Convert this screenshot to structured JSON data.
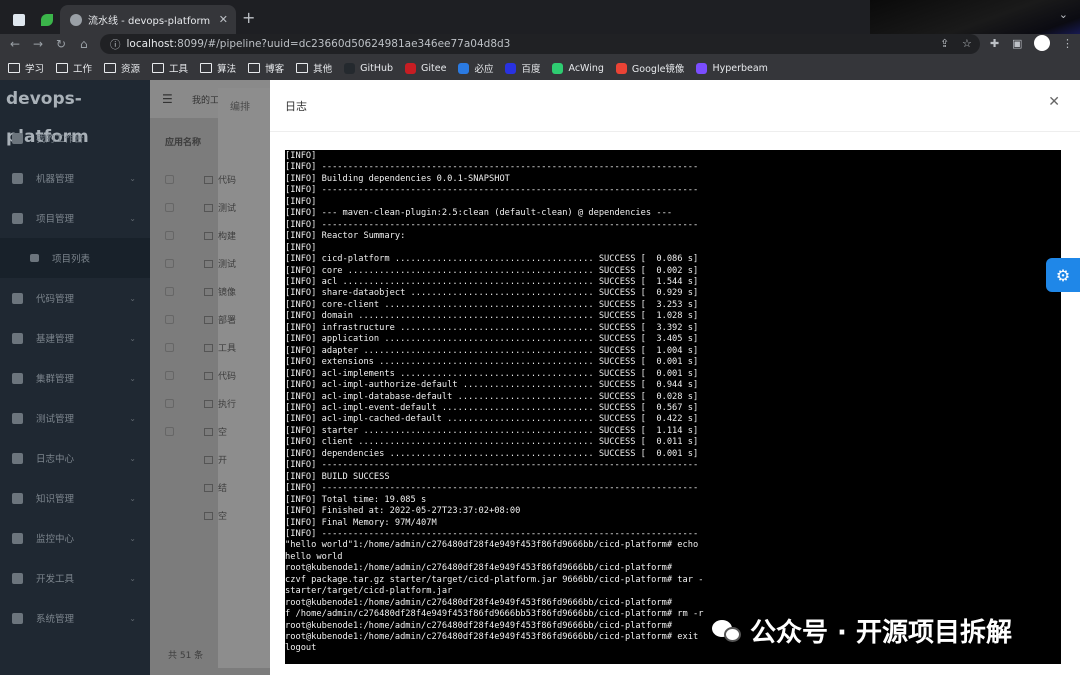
{
  "browser": {
    "active_tab_title": "流水线 - devops-platform",
    "url_host": "localhost",
    "url_rest": ":8099/#/pipeline?uuid=dc23660d50624981ae346ee77a04d8d3",
    "bookmarks": [
      "学习",
      "工作",
      "资源",
      "工具",
      "算法",
      "博客",
      "其他",
      "GitHub",
      "Gitee",
      "必应",
      "百度",
      "AcWing",
      "Google镜像",
      "Hyperbeam"
    ],
    "bookmark_colors": {
      "GitHub": "#24292e",
      "Gitee": "#c71d23",
      "必应": "#2a7ae2",
      "百度": "#2932e1",
      "AcWing": "#2ecc71",
      "Google镜像": "#ea4335",
      "Hyperbeam": "#7b4dff"
    }
  },
  "sidebar": {
    "logo": "devops-platform",
    "items": [
      {
        "label": "我的工作台",
        "icon": "dashboard-icon",
        "arrow": false
      },
      {
        "label": "机器管理",
        "icon": "grid-icon",
        "arrow": true
      },
      {
        "label": "项目管理",
        "icon": "edit-icon",
        "arrow": true
      },
      {
        "label": "项目列表",
        "icon": "list-icon",
        "arrow": false,
        "sub": true
      },
      {
        "label": "代码管理",
        "icon": "code-icon",
        "arrow": true
      },
      {
        "label": "基建管理",
        "icon": "build-icon",
        "arrow": true
      },
      {
        "label": "集群管理",
        "icon": "send-icon",
        "arrow": true
      },
      {
        "label": "测试管理",
        "icon": "chart-icon",
        "arrow": true
      },
      {
        "label": "日志中心",
        "icon": "file-icon",
        "arrow": true
      },
      {
        "label": "知识管理",
        "icon": "book-icon",
        "arrow": true
      },
      {
        "label": "监控中心",
        "icon": "eye-icon",
        "arrow": true
      },
      {
        "label": "开发工具",
        "icon": "tool-icon",
        "arrow": true
      },
      {
        "label": "系统管理",
        "icon": "setting-icon",
        "arrow": true
      }
    ]
  },
  "main": {
    "topbar_text": "我的工",
    "tab_text": "编排",
    "column_header": "应用名称",
    "rows": [
      "代码",
      "测试",
      "构建",
      "测试",
      "镜像",
      "部署",
      "工具",
      "代码",
      "执行",
      "空",
      "开",
      "结",
      "空"
    ],
    "total": "共 51 条"
  },
  "modal": {
    "title": "日志",
    "log_lines": [
      "[INFO]",
      "[INFO] ------------------------------------------------------------------------",
      "[INFO] Building dependencies 0.0.1-SNAPSHOT",
      "[INFO] ------------------------------------------------------------------------",
      "[INFO]",
      "[INFO] --- maven-clean-plugin:2.5:clean (default-clean) @ dependencies ---",
      "[INFO] ------------------------------------------------------------------------",
      "[INFO] Reactor Summary:",
      "[INFO]",
      "[INFO] cicd-platform ...................................... SUCCESS [  0.086 s]",
      "[INFO] core ............................................... SUCCESS [  0.002 s]",
      "[INFO] acl ................................................ SUCCESS [  1.544 s]",
      "[INFO] share-dataobject ................................... SUCCESS [  0.929 s]",
      "[INFO] core-client ........................................ SUCCESS [  3.253 s]",
      "[INFO] domain ............................................. SUCCESS [  1.028 s]",
      "[INFO] infrastructure ..................................... SUCCESS [  3.392 s]",
      "[INFO] application ........................................ SUCCESS [  3.405 s]",
      "[INFO] adapter ............................................ SUCCESS [  1.004 s]",
      "[INFO] extensions ......................................... SUCCESS [  0.001 s]",
      "[INFO] acl-implements ..................................... SUCCESS [  0.001 s]",
      "[INFO] acl-impl-authorize-default ......................... SUCCESS [  0.944 s]",
      "[INFO] acl-impl-database-default .......................... SUCCESS [  0.028 s]",
      "[INFO] acl-impl-event-default ............................. SUCCESS [  0.567 s]",
      "[INFO] acl-impl-cached-default ............................ SUCCESS [  0.422 s]",
      "[INFO] starter ............................................ SUCCESS [  1.114 s]",
      "[INFO] client ............................................. SUCCESS [  0.011 s]",
      "[INFO] dependencies ....................................... SUCCESS [  0.001 s]",
      "[INFO] ------------------------------------------------------------------------",
      "[INFO] BUILD SUCCESS",
      "[INFO] ------------------------------------------------------------------------",
      "[INFO] Total time: 19.085 s",
      "[INFO] Finished at: 2022-05-27T23:37:02+08:00",
      "[INFO] Final Memory: 97M/407M",
      "[INFO] ------------------------------------------------------------------------",
      "\"hello world\"1:/home/admin/c276480df28f4e949f453f86fd9666bb/cicd-platform# echo",
      "hello world",
      "root@kubenode1:/home/admin/c276480df28f4e949f453f86fd9666bb/cicd-platform#",
      "czvf package.tar.gz starter/target/cicd-platform.jar 9666bb/cicd-platform# tar -",
      "starter/target/cicd-platform.jar",
      "root@kubenode1:/home/admin/c276480df28f4e949f453f86fd9666bb/cicd-platform#",
      "f /home/admin/c276480df28f4e949f453f86fd9666bb53f86fd9666bb/cicd-platform# rm -r",
      "root@kubenode1:/home/admin/c276480df28f4e949f453f86fd9666bb/cicd-platform#",
      "root@kubenode1:/home/admin/c276480df28f4e949f453f86fd9666bb/cicd-platform# exit",
      "logout"
    ]
  },
  "watermark": "公众号 · 开源项目拆解"
}
